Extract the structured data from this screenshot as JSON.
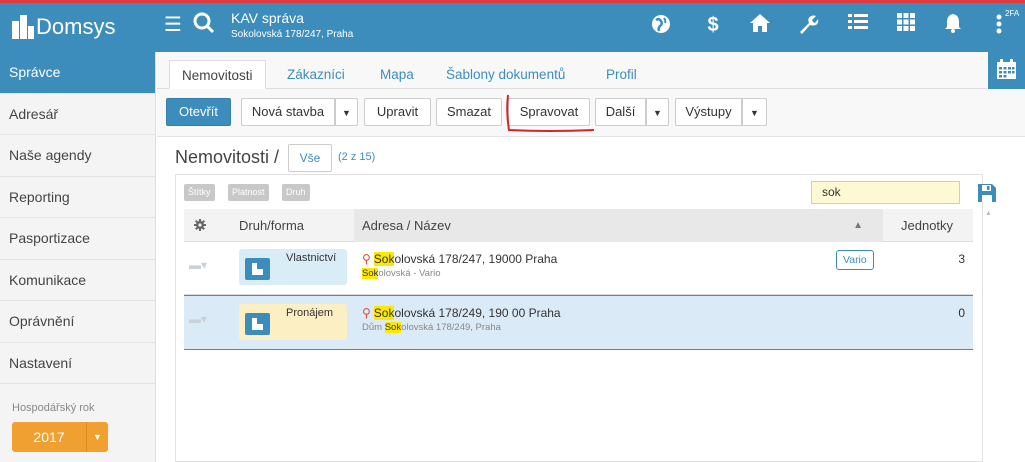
{
  "app": {
    "logo_text": "Domsys",
    "context_title": "KAV správa",
    "context_subtitle": "Sokolovská 178/247, Praha",
    "twofa_badge": "2FA",
    "top_icons": [
      "menu-icon",
      "search-icon",
      "globe-icon",
      "dollar-icon",
      "home-icon",
      "wrench-icon",
      "list-icon",
      "grid-icon",
      "bell-icon",
      "more-vertical-icon"
    ]
  },
  "sidebar": {
    "items": [
      {
        "label": "Správce",
        "active": true
      },
      {
        "label": "Adresář",
        "active": false
      },
      {
        "label": "Naše agendy",
        "active": false
      },
      {
        "label": "Reporting",
        "active": false
      },
      {
        "label": "Pasportizace",
        "active": false
      },
      {
        "label": "Komunikace",
        "active": false
      },
      {
        "label": "Oprávnění",
        "active": false
      },
      {
        "label": "Nastavení",
        "active": false
      }
    ],
    "fiscal_year_label": "Hospodářský rok",
    "fiscal_year_value": "2017"
  },
  "tabs": [
    {
      "label": "Nemovitosti",
      "active": true
    },
    {
      "label": "Zákazníci",
      "active": false
    },
    {
      "label": "Mapa",
      "active": false
    },
    {
      "label": "Šablony dokumentů",
      "active": false
    },
    {
      "label": "Profil",
      "active": false
    }
  ],
  "toolbar": {
    "open": "Otevřít",
    "new_building": "Nová stavba",
    "edit": "Upravit",
    "delete": "Smazat",
    "manage": "Spravovat",
    "more": "Další",
    "outputs": "Výstupy"
  },
  "section": {
    "title": "Nemovitosti /",
    "filter_all": "Vše",
    "count": "(2 z 15)"
  },
  "filters": {
    "chips": [
      "Štítky",
      "Platnost",
      "Druh"
    ],
    "search_value": "sok"
  },
  "table": {
    "columns": {
      "type": "Druh/forma",
      "address": "Adresa / Název",
      "units": "Jednotky"
    },
    "rows": [
      {
        "type": "Vlastnictví",
        "type_color": "#d9edf7",
        "addr_hl": "Sok",
        "addr_rest": "olovská 178/247, 19000 Praha",
        "sub_pre": "",
        "sub_hl": "Sok",
        "sub_rest": "olovská - Vario",
        "tag": "Vario",
        "units": "3",
        "selected": false
      },
      {
        "type": "Pronájem",
        "type_color": "#fcefc4",
        "addr_hl": "Sok",
        "addr_rest": "olovská 178/249, 190 00 Praha",
        "sub_pre": "Dům ",
        "sub_hl": "Sok",
        "sub_rest": "olovská 178/249, Praha",
        "tag": "",
        "units": "0",
        "selected": true
      }
    ]
  },
  "colors": {
    "primary": "#3c8dbc",
    "accent": "#f0a030",
    "highlight": "#ffe800",
    "alert_line": "#e0393e"
  }
}
